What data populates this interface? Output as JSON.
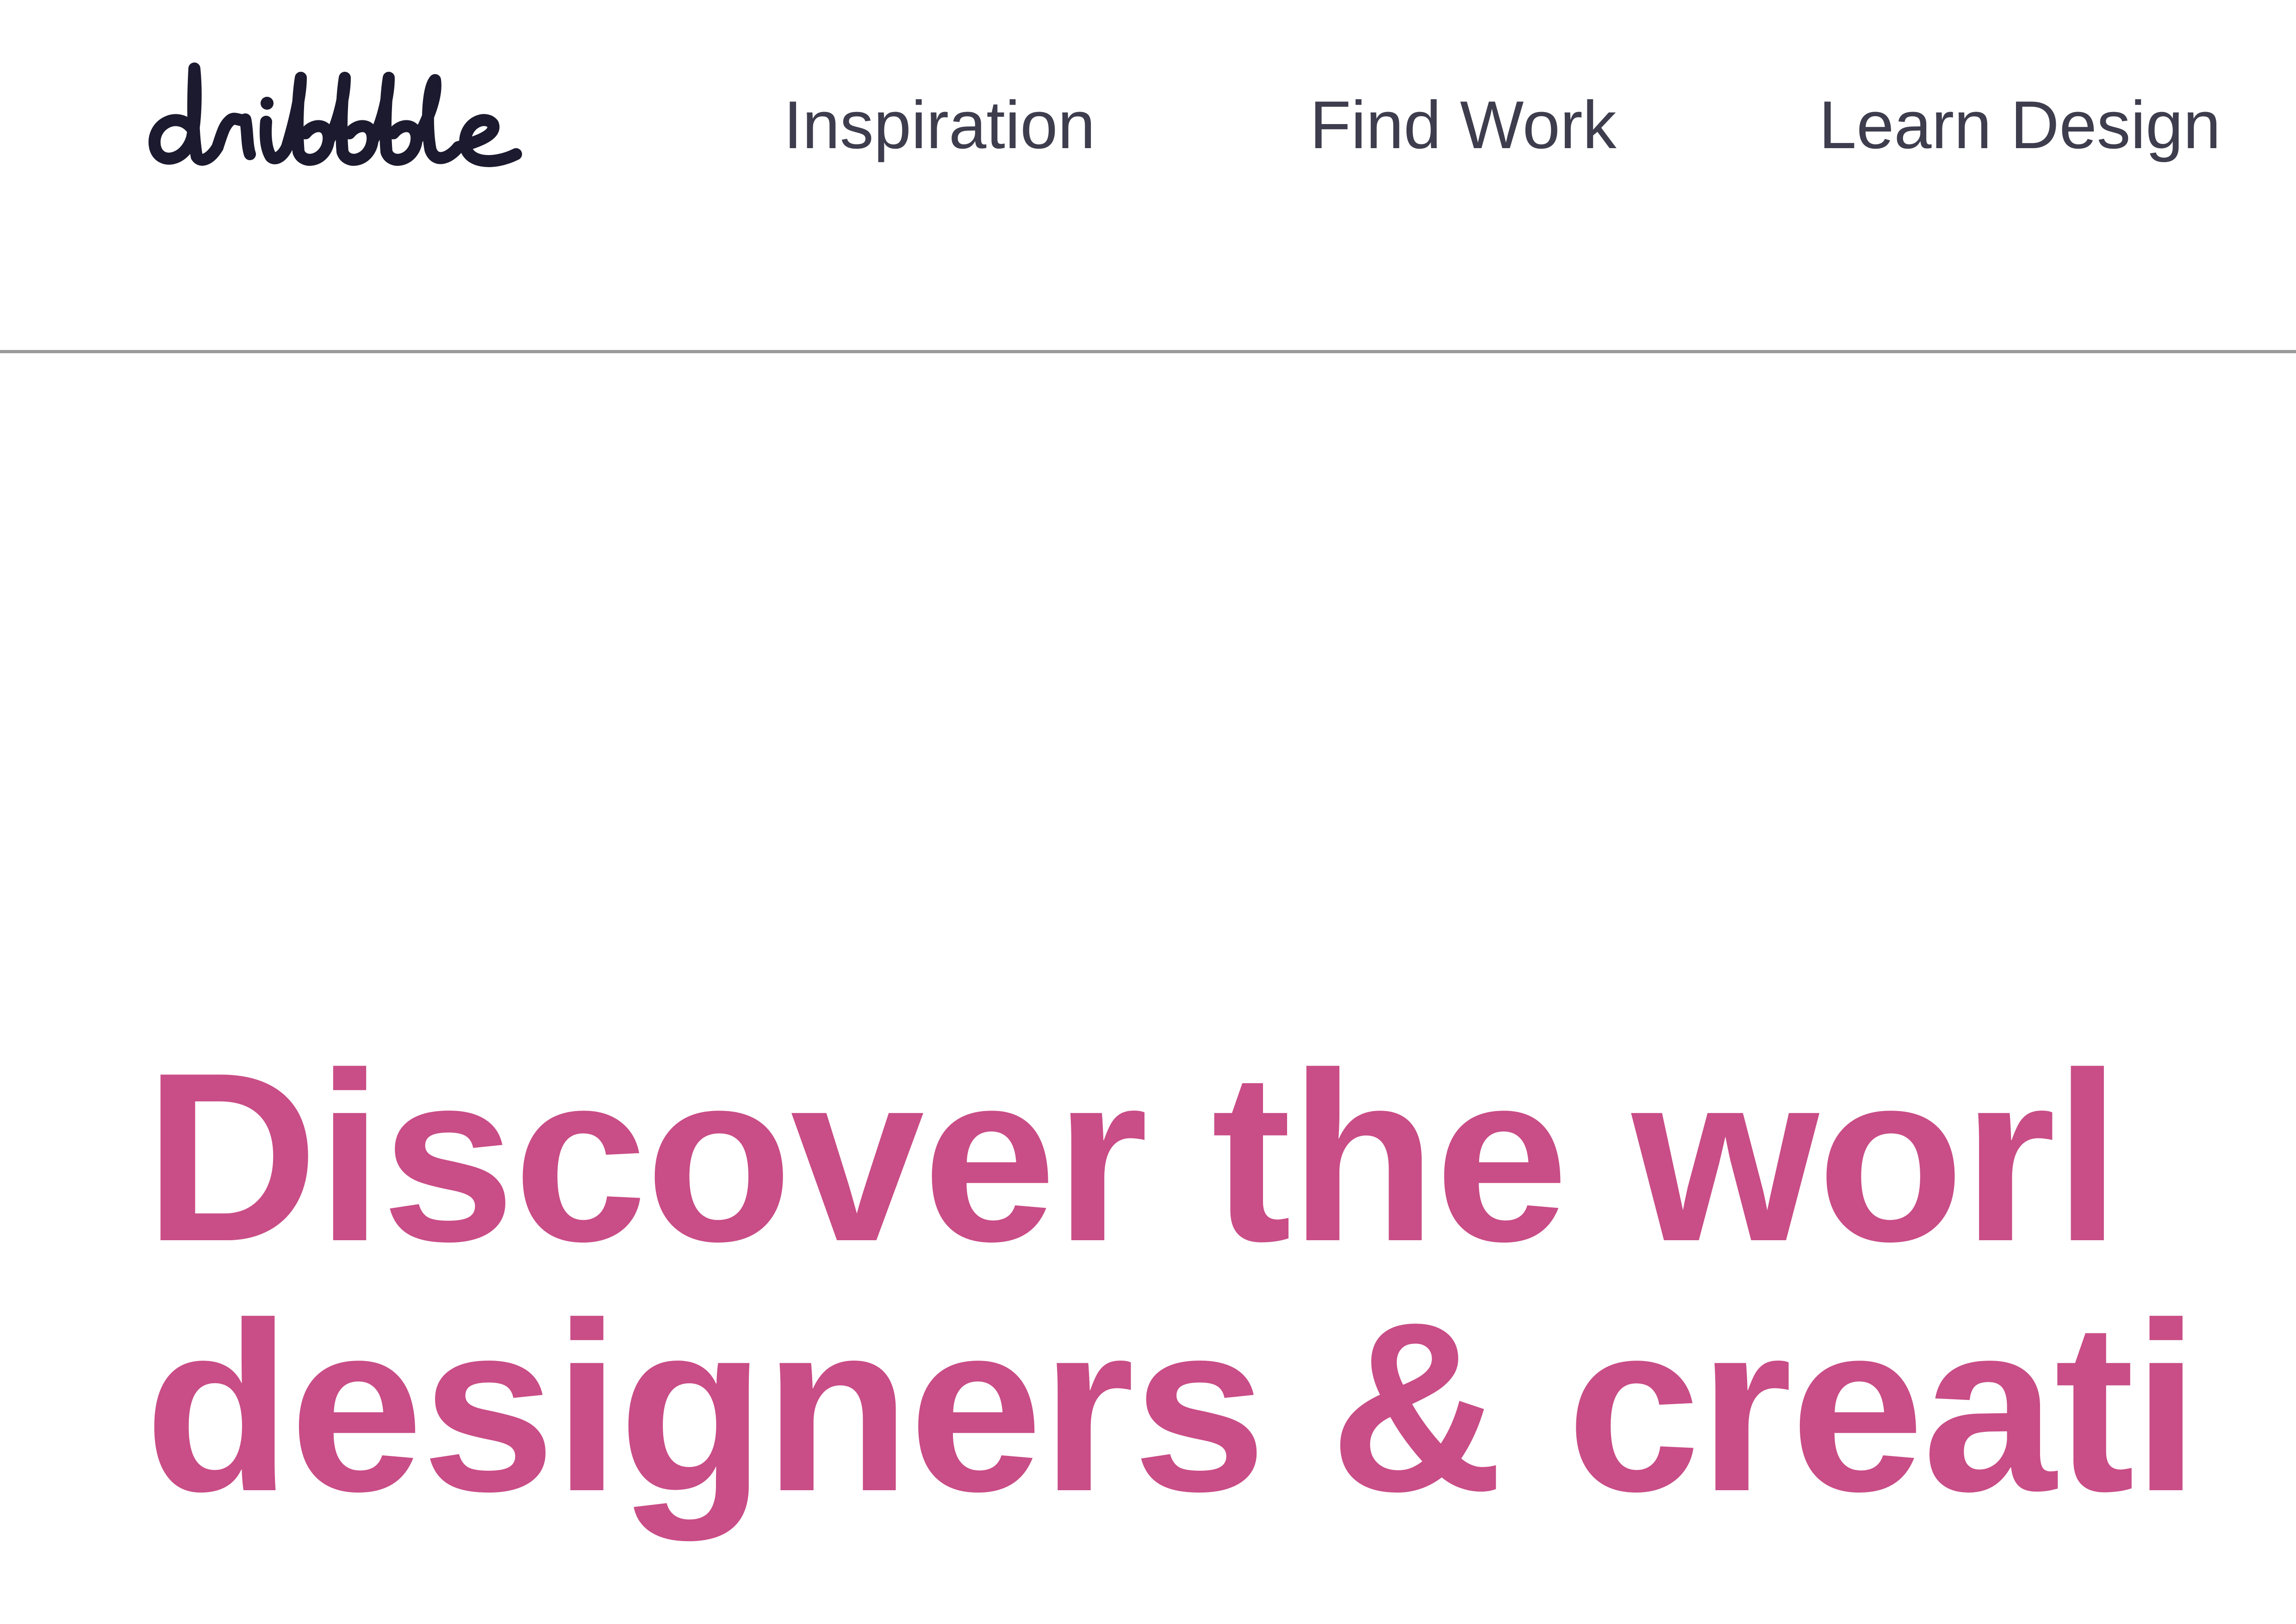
{
  "header": {
    "logo_text": "dribbble",
    "nav": [
      {
        "label": "Inspiration"
      },
      {
        "label": "Find Work"
      },
      {
        "label": "Learn Design"
      }
    ]
  },
  "hero": {
    "headline_line1": "Discover the worl",
    "headline_line2": "designers & creati"
  },
  "colors": {
    "accent": "#c94d86",
    "nav_text": "#3d3d4e",
    "logo": "#1b1a2e",
    "divider": "#9a9a9a",
    "background": "#ffffff"
  },
  "icons": [
    "dribbble-logo"
  ]
}
